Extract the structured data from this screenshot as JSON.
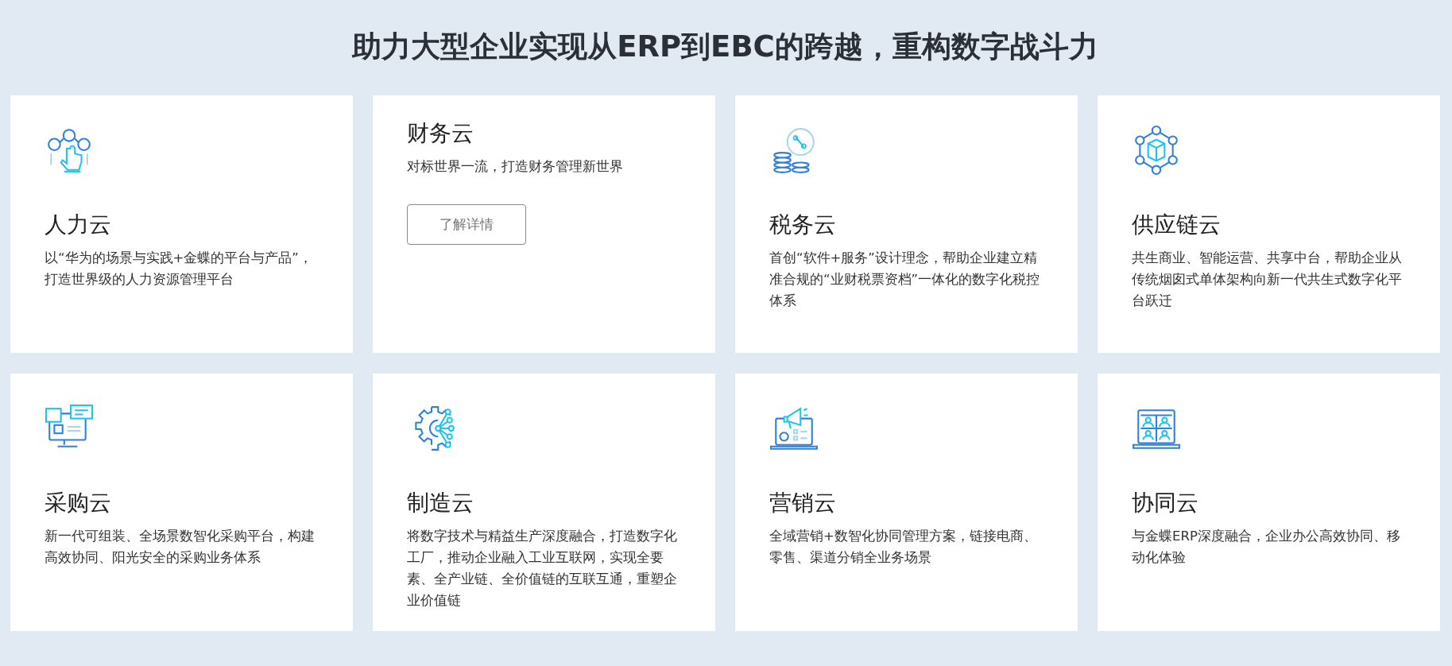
{
  "heading": "助力大型企业实现从ERP到EBC的跨越，重构数字战斗力",
  "cards": [
    {
      "kind": "icon",
      "title": "人力云",
      "description": "以“华为的场景与实践+金蝶的平台与产品”，打造世界级的人力资源管理平台"
    },
    {
      "kind": "button",
      "title": "财务云",
      "description": "对标世界一流，打造财务管理新世界",
      "button": "了解详情"
    },
    {
      "kind": "icon",
      "title": "税务云",
      "description": "首创“软件+服务”设计理念，帮助企业建立精准合规的“业财税票资档”一体化的数字化税控体系"
    },
    {
      "kind": "icon",
      "title": "供应链云",
      "description": "共生商业、智能运营、共享中台，帮助企业从传统烟囱式单体架构向新一代共生式数字化平台跃迁"
    },
    {
      "kind": "icon",
      "title": "采购云",
      "description": "新一代可组装、全场景数智化采购平台，构建高效协同、阳光安全的采购业务体系"
    },
    {
      "kind": "icon",
      "title": "制造云",
      "description": "将数字技术与精益生产深度融合，打造数字化工厂，推动企业融入工业互联网，实现全要素、全产业链、全价值链的互联互通，重塑企业价值链"
    },
    {
      "kind": "icon",
      "title": "营销云",
      "description": "全域营销+数智化协同管理方案，链接电商、零售、渠道分销全业务场景"
    },
    {
      "kind": "icon",
      "title": "协同云",
      "description": "与金蝶ERP深度融合，企业办公高效协同、移动化体验"
    }
  ]
}
